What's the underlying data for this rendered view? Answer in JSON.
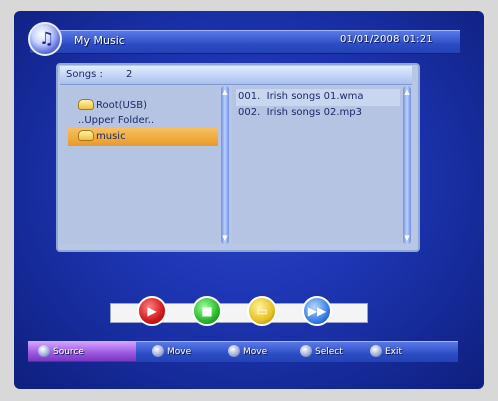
{
  "header": {
    "title": "My Music",
    "datetime": "01/01/2008 01:21"
  },
  "panel": {
    "songs_label": "Songs :",
    "songs_count": "2"
  },
  "folders": [
    {
      "label": "Root(USB)"
    },
    {
      "label": "..Upper Folder.."
    },
    {
      "label": "music"
    }
  ],
  "files": [
    {
      "index": "001.",
      "name": "Irish songs 01.wma"
    },
    {
      "index": "002.",
      "name": "Irish songs 02.mp3"
    }
  ],
  "controls": {
    "play_icon": "play-icon",
    "stop_icon": "stop-icon",
    "repeat_icon": "repeat-icon",
    "fast_forward_icon": "fast-forward-icon"
  },
  "help": {
    "source": "Source",
    "move1": "Move",
    "move2": "Move",
    "select": "Select",
    "exit": "Exit"
  },
  "colors": {
    "screen_bg": "#1c34b0",
    "panel_bg": "#b4c4e2",
    "selected_folder": "#f0a838",
    "title_bar": "#2c4cc4",
    "source_key": "#9a58e0"
  }
}
